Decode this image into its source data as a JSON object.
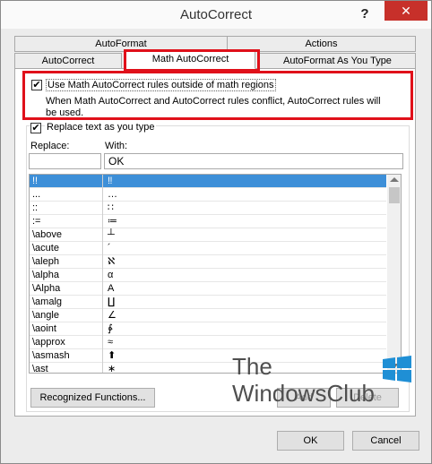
{
  "window": {
    "title": "AutoCorrect",
    "help": "?",
    "close": "✕"
  },
  "tabs": {
    "row1": [
      "AutoFormat",
      "Actions"
    ],
    "row2": [
      "AutoCorrect",
      "Math AutoCorrect",
      "AutoFormat As You Type"
    ]
  },
  "options": {
    "outside_math": "Use Math AutoCorrect rules outside of math regions",
    "conflict_note_1": "When Math AutoCorrect and AutoCorrect rules conflict, AutoCorrect rules will",
    "conflict_note_2": "be used.",
    "replace_text": "Replace text as you type"
  },
  "fields": {
    "replace_label": "Replace:",
    "with_label": "With:",
    "replace_value": "",
    "with_value": "OK"
  },
  "entries": [
    {
      "replace": "!!",
      "with": "‼"
    },
    {
      "replace": "...",
      "with": "…"
    },
    {
      "replace": "::",
      "with": "∷"
    },
    {
      "replace": ":=",
      "with": "≔"
    },
    {
      "replace": "\\above",
      "with": "┴"
    },
    {
      "replace": "\\acute",
      "with": "´"
    },
    {
      "replace": "\\aleph",
      "with": "ℵ"
    },
    {
      "replace": "\\alpha",
      "with": "α"
    },
    {
      "replace": "\\Alpha",
      "with": "A"
    },
    {
      "replace": "\\amalg",
      "with": "∐"
    },
    {
      "replace": "\\angle",
      "with": "∠"
    },
    {
      "replace": "\\aoint",
      "with": "∳"
    },
    {
      "replace": "\\approx",
      "with": "≈"
    },
    {
      "replace": "\\asmash",
      "with": "⬆"
    },
    {
      "replace": "\\ast",
      "with": "∗"
    }
  ],
  "buttons": {
    "recognized": "Recognized Functions...",
    "add": "Add",
    "delete": "Delete",
    "ok": "OK",
    "cancel": "Cancel"
  },
  "watermark": {
    "line1": "The",
    "line2": "WindowsClub"
  }
}
